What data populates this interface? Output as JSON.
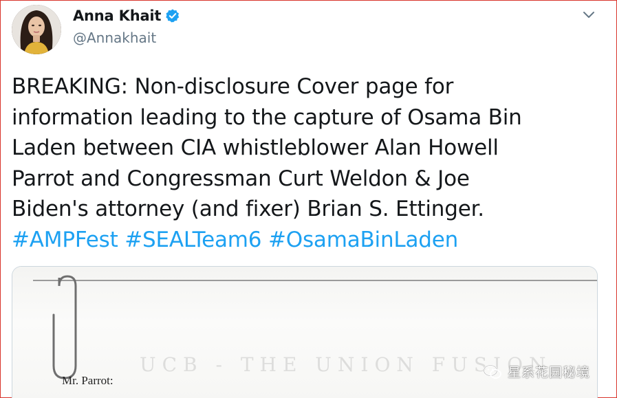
{
  "author": {
    "name": "Anna Khait",
    "handle": "@Annakhait",
    "verified": true
  },
  "tweet": {
    "lines": [
      "BREAKING: Non-disclosure Cover page for",
      "information leading to the capture of Osama Bin",
      "Laden between CIA whistleblower Alan Howell",
      "Parrot and Congressman Curt Weldon & Joe",
      "Biden's attorney (and fixer) Brian S. Ettinger."
    ],
    "hashtags": [
      "#AMPFest",
      "#SEALTeam6",
      "#OsamaBinLaden"
    ]
  },
  "media": {
    "document_header_faint": "UCB - THE UNION FUSION",
    "salutation": "Mr. Parrot:"
  },
  "watermark": {
    "text": "星系花园秘境",
    "icon": "wechat-icon"
  },
  "colors": {
    "hashtag": "#1da1f2",
    "handle": "#657786",
    "verified": "#1da1f2",
    "frame_border": "#d9342b"
  },
  "icons": {
    "menu": "chevron-down-icon",
    "verified": "verified-badge-icon"
  }
}
